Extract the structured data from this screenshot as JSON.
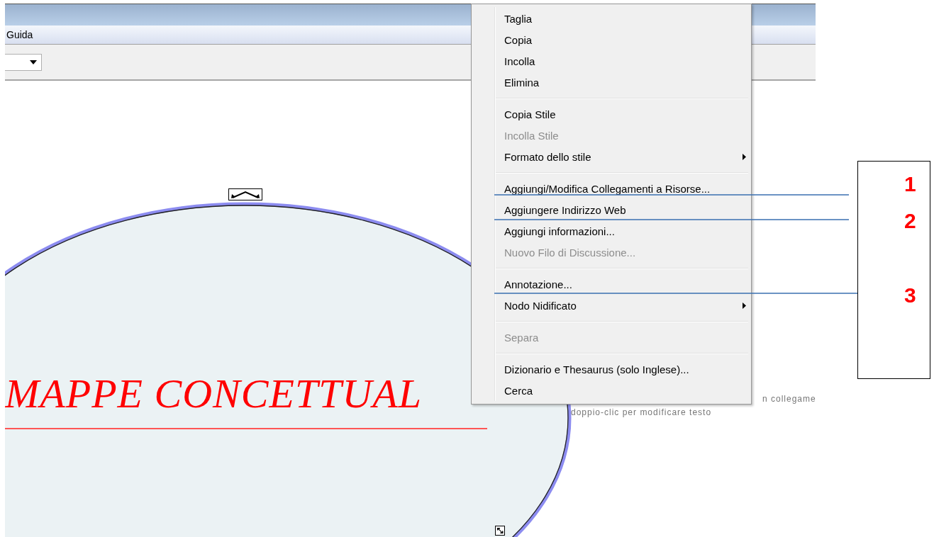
{
  "menu_bar": [
    {
      "label": "Guida"
    }
  ],
  "map": {
    "node": {
      "title": "MAPPE CONCETTUAL"
    },
    "hints": [
      "n collegame",
      "doppio-clic per modificare testo"
    ]
  },
  "context_menu": {
    "items": [
      {
        "kind": "item",
        "label": "Taglia",
        "disabled": false,
        "submenu": false
      },
      {
        "kind": "item",
        "label": "Copia",
        "disabled": false,
        "submenu": false
      },
      {
        "kind": "item",
        "label": "Incolla",
        "disabled": false,
        "submenu": false
      },
      {
        "kind": "item",
        "label": "Elimina",
        "disabled": false,
        "submenu": false
      },
      {
        "kind": "separator"
      },
      {
        "kind": "item",
        "label": "Copia Stile",
        "disabled": false,
        "submenu": false
      },
      {
        "kind": "item",
        "label": "Incolla Stile",
        "disabled": true,
        "submenu": false
      },
      {
        "kind": "item",
        "label": "Formato dello stile",
        "disabled": false,
        "submenu": true
      },
      {
        "kind": "separator"
      },
      {
        "kind": "item",
        "label": "Aggiungi/Modifica Collegamenti a Risorse...",
        "disabled": false,
        "submenu": false
      },
      {
        "kind": "item",
        "label": "Aggiungere Indirizzo Web",
        "disabled": false,
        "submenu": false
      },
      {
        "kind": "item",
        "label": "Aggiungi informazioni...",
        "disabled": false,
        "submenu": false
      },
      {
        "kind": "item",
        "label": "Nuovo Filo di Discussione...",
        "disabled": true,
        "submenu": false
      },
      {
        "kind": "separator"
      },
      {
        "kind": "item",
        "label": "Annotazione...",
        "disabled": false,
        "submenu": false
      },
      {
        "kind": "item",
        "label": "Nodo Nidificato",
        "disabled": false,
        "submenu": true
      },
      {
        "kind": "separator"
      },
      {
        "kind": "item",
        "label": "Separa",
        "disabled": true,
        "submenu": false
      },
      {
        "kind": "separator"
      },
      {
        "kind": "item",
        "label": "Dizionario e Thesaurus (solo Inglese)...",
        "disabled": false,
        "submenu": false
      },
      {
        "kind": "item",
        "label": "Cerca",
        "disabled": false,
        "submenu": false
      }
    ]
  },
  "callouts": [
    "1",
    "2",
    "3"
  ]
}
